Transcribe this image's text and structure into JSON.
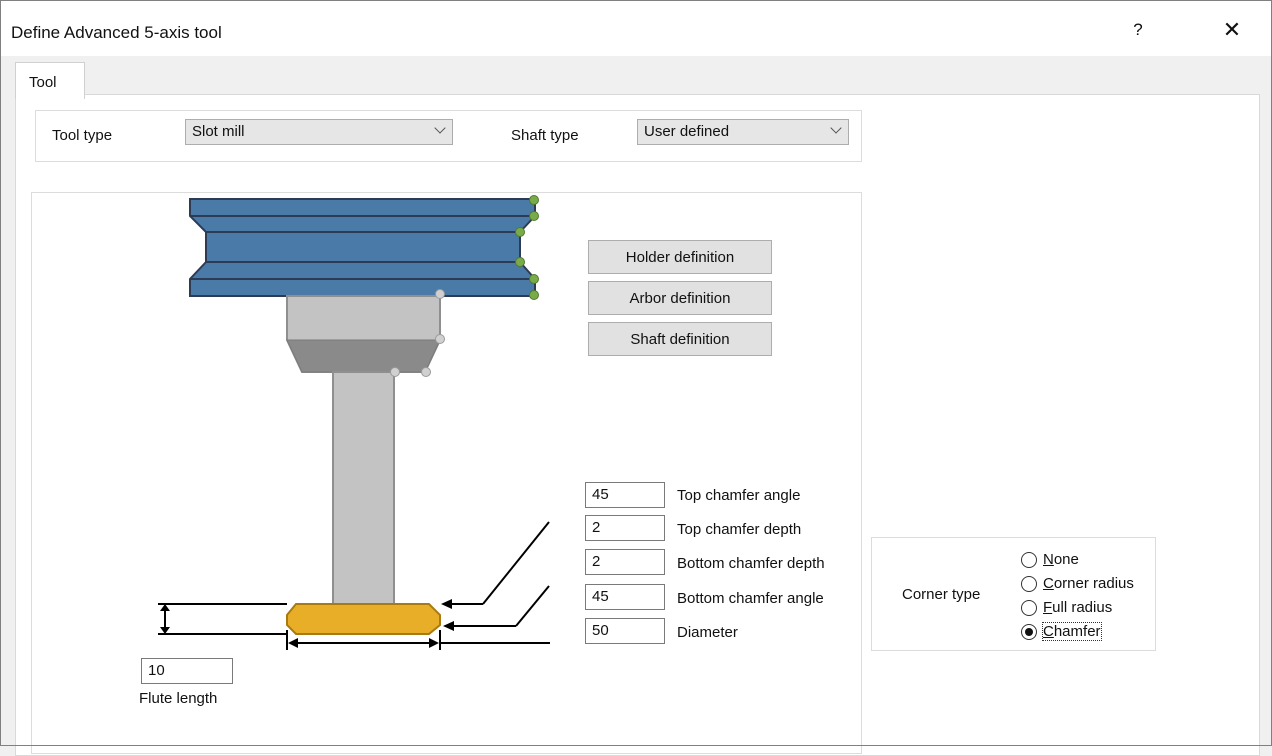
{
  "window": {
    "title": "Define Advanced 5-axis tool",
    "help_label": "?",
    "close_label": "✕"
  },
  "tabs": [
    {
      "label": "Tool"
    }
  ],
  "tool_type": {
    "label": "Tool type",
    "value": "Slot mill"
  },
  "shaft_type": {
    "label": "Shaft type",
    "value": "User defined"
  },
  "buttons": {
    "holder": "Holder definition",
    "arbor": "Arbor definition",
    "shaft": "Shaft definition"
  },
  "parameters": [
    {
      "value": "45",
      "label": "Top chamfer angle"
    },
    {
      "value": "2",
      "label": "Top chamfer depth"
    },
    {
      "value": "2",
      "label": "Bottom chamfer depth"
    },
    {
      "value": "45",
      "label": "Bottom chamfer angle"
    },
    {
      "value": "50",
      "label": "Diameter"
    }
  ],
  "flute_length": {
    "value": "10",
    "label": "Flute length"
  },
  "corner_type": {
    "label": "Corner type",
    "options": [
      {
        "pre": "",
        "ul": "N",
        "post": "one",
        "checked": false
      },
      {
        "pre": "",
        "ul": "C",
        "post": "orner radius",
        "checked": false
      },
      {
        "pre": "",
        "ul": "F",
        "post": "ull radius",
        "checked": false
      },
      {
        "pre": "",
        "ul": "C",
        "post": "hamfer",
        "checked": true
      }
    ]
  },
  "colors": {
    "holder": "#4a7aa8",
    "holder_stroke": "#2d3b55",
    "arbor": "#c3c3c3",
    "shaft": "#c3c3c3",
    "cutter": "#e8ae28",
    "handle_green": "#7aab4a"
  }
}
